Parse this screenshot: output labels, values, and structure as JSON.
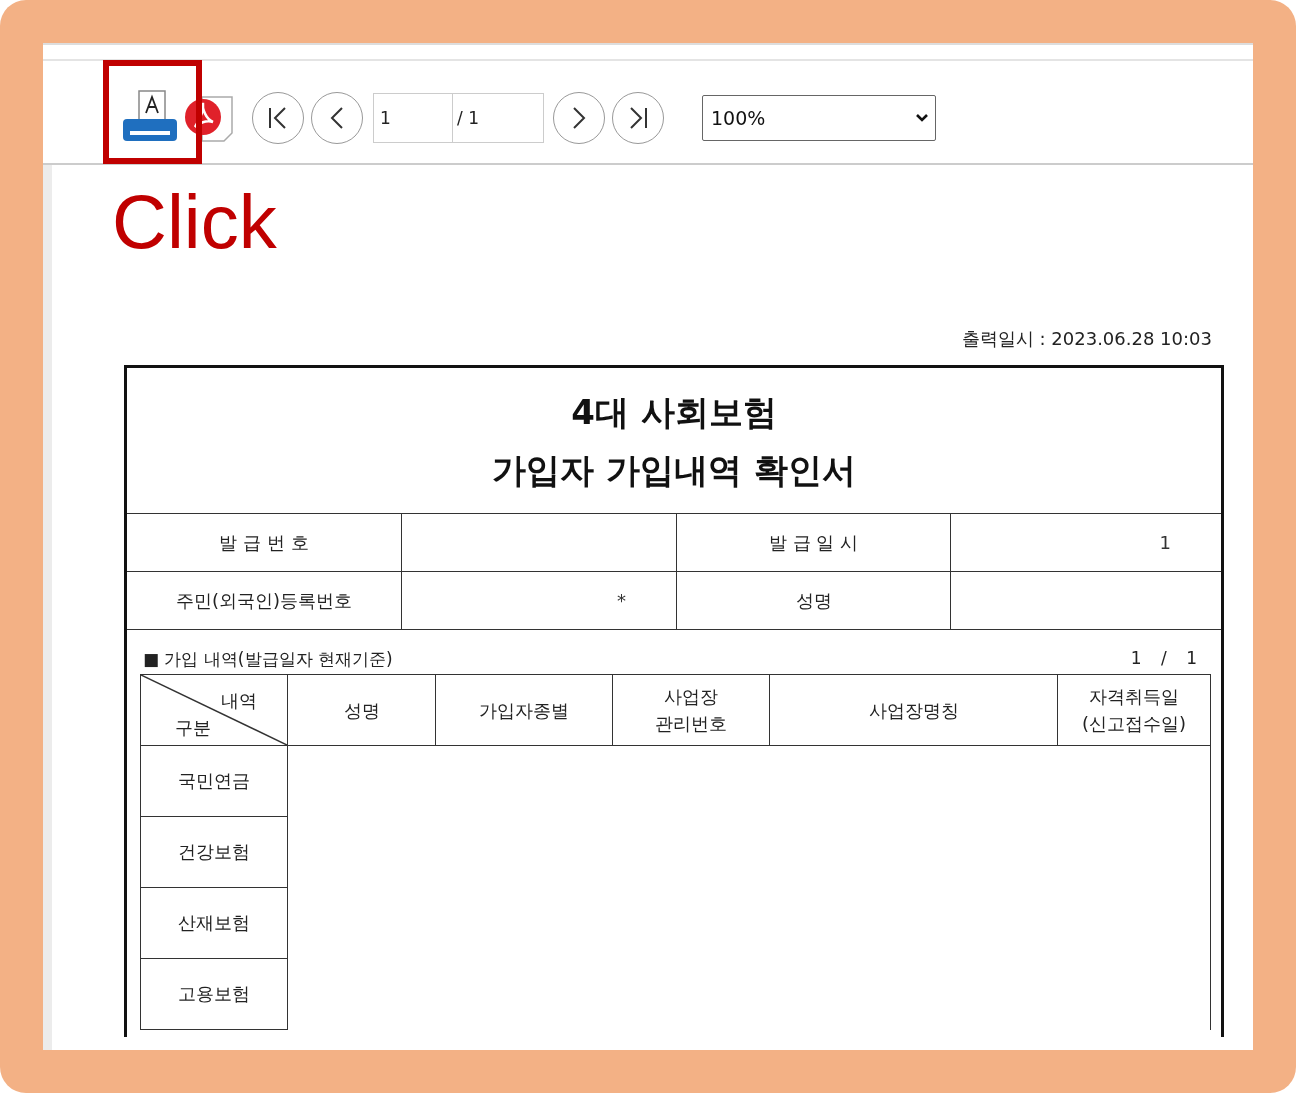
{
  "toolbar": {
    "page_field": {
      "value": "1"
    },
    "page_total": "/ 1",
    "zoom": {
      "value": "100%"
    }
  },
  "annotation": {
    "text": "Click"
  },
  "print_time": "출력일시 : 2023.06.28 10:03",
  "document": {
    "title": [
      "4대 사회보험",
      "가입자 가입내역 확인서"
    ],
    "info_rows": [
      {
        "cells": [
          {
            "kind": "label",
            "text": "발 급 번 호"
          },
          {
            "kind": "value"
          },
          {
            "kind": "label",
            "text": "발 급 일 시"
          },
          {
            "kind": "value",
            "text": "1"
          }
        ]
      },
      {
        "cells": [
          {
            "kind": "label",
            "text": "주민(외국인)등록번호"
          },
          {
            "kind": "value",
            "text": "*"
          },
          {
            "kind": "label",
            "text": "성명"
          },
          {
            "kind": "value"
          }
        ]
      }
    ],
    "section": {
      "title": "■ 가입 내역(발급일자 현재기준)",
      "page": "1 / 1"
    },
    "table": {
      "corner": {
        "top": "내역",
        "bottom": "구분"
      },
      "columns": [
        {
          "lines": [
            "성명"
          ]
        },
        {
          "lines": [
            "가입자종별"
          ]
        },
        {
          "lines": [
            "사업장",
            "관리번호"
          ]
        },
        {
          "lines": [
            "사업장명칭"
          ]
        },
        {
          "lines": [
            "자격취득일",
            "(신고접수일)"
          ]
        }
      ],
      "rows": [
        "국민연금",
        "건강보험",
        "산재보험",
        "고용보험"
      ]
    }
  }
}
